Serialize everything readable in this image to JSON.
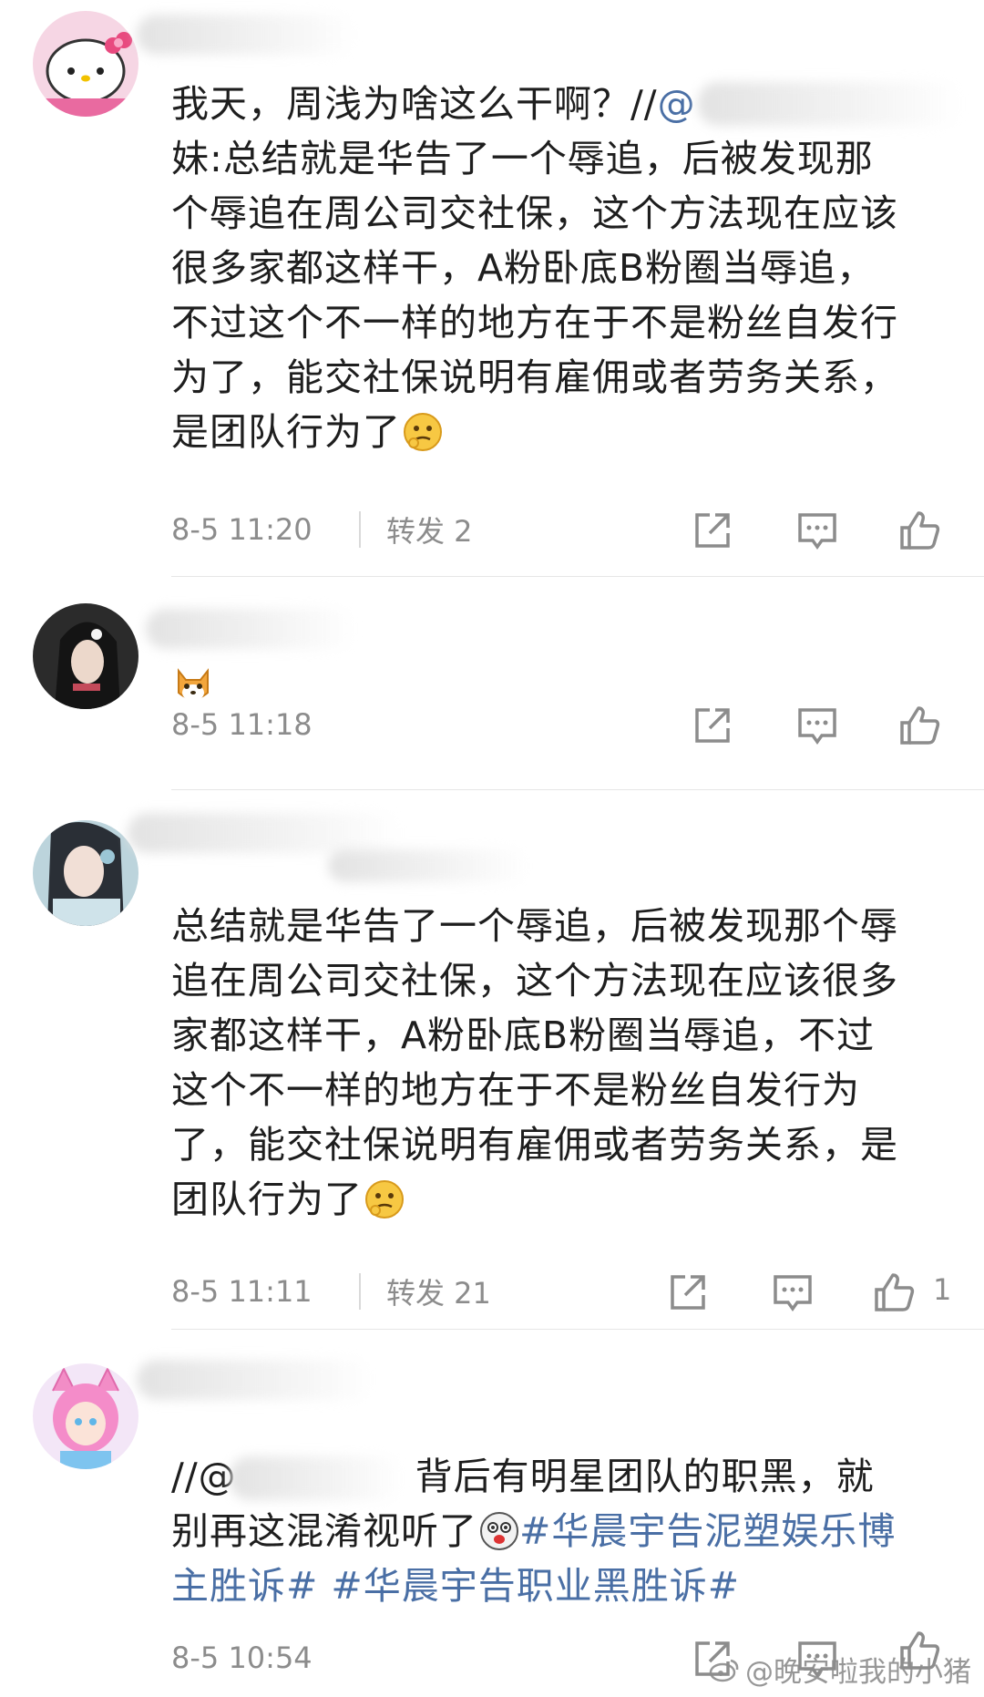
{
  "comments": [
    {
      "time": "8-5 11:20",
      "repost_label": "转发 2",
      "line1_prefix": "我天，周浅为啥这么干啊？//",
      "mention_partial": "@",
      "lines": [
        "妹:总结就是华告了一个辱追，后被发现那",
        "个辱追在周公司交社保，这个方法现在应该",
        "很多家都这样干，A粉卧底B粉圈当辱追，",
        "不过这个不一样的地方在于不是粉丝自发行",
        "为了，能交社保说明有雇佣或者劳务关系，",
        "是团队行为了"
      ],
      "emoji": "thinking-face-emoji"
    },
    {
      "time": "8-5 11:18",
      "emoji": "cat-face-emoji"
    },
    {
      "time": "8-5 11:11",
      "repost_label": "转发 21",
      "like_count": "1",
      "lines": [
        "总结就是华告了一个辱追，后被发现那个辱",
        "追在周公司交社保，这个方法现在应该很多",
        "家都这样干，A粉卧底B粉圈当辱追，不过",
        "这个不一样的地方在于不是粉丝自发行为",
        "了，能交社保说明有雇佣或者劳务关系，是",
        "团队行为了"
      ],
      "emoji": "thinking-face-emoji"
    },
    {
      "time": "8-5 10:54",
      "line1_prefix": "//@",
      "line1_suffix": "背后有明星团队的职黑，就",
      "line2_prefix": "别再这混淆视听了",
      "tag1_part1": "#华晨宇告泥塑娱乐博",
      "tag1_part2": "主胜诉#",
      "tag2": "#华晨宇告职业黑胜诉#",
      "emoji": "ghost-face-emoji"
    }
  ],
  "watermark": "@晚安啦我的小猪",
  "icons": [
    "repost-icon",
    "comment-icon",
    "like-icon"
  ],
  "colors": {
    "link": "#4a6fa5",
    "meta": "#8c8c8c",
    "divider": "#e6e6e6"
  }
}
